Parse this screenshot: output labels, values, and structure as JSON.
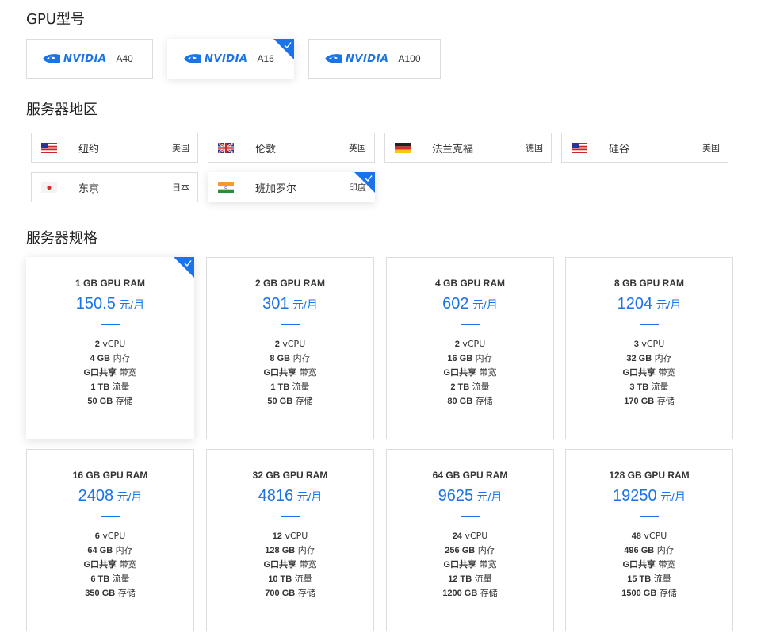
{
  "sections": {
    "gpu_title": "GPU型号",
    "region_title": "服务器地区",
    "spec_title": "服务器规格"
  },
  "gpu": {
    "brand": "NVIDIA",
    "options": [
      {
        "model": "A40",
        "selected": false
      },
      {
        "model": "A16",
        "selected": true
      },
      {
        "model": "A100",
        "selected": false
      }
    ]
  },
  "regions": [
    {
      "city": "纽约",
      "country": "美国",
      "flag": "us-flag",
      "selected": false
    },
    {
      "city": "伦敦",
      "country": "英国",
      "flag": "uk-flag",
      "selected": false
    },
    {
      "city": "法兰克福",
      "country": "德国",
      "flag": "de-flag",
      "selected": false
    },
    {
      "city": "硅谷",
      "country": "美国",
      "flag": "us-flag",
      "selected": false
    },
    {
      "city": "东京",
      "country": "日本",
      "flag": "jp-flag",
      "selected": false
    },
    {
      "city": "班加罗尔",
      "country": "印度",
      "flag": "in-flag",
      "selected": true
    }
  ],
  "price_unit": "元/月",
  "specs": [
    {
      "ram": "1 GB GPU RAM",
      "price": "150.5",
      "vcpu": "2",
      "mem": "4 GB",
      "bw": "G口共享",
      "traffic": "1 TB",
      "disk": "50 GB",
      "selected": true
    },
    {
      "ram": "2 GB GPU RAM",
      "price": "301",
      "vcpu": "2",
      "mem": "8 GB",
      "bw": "G口共享",
      "traffic": "1 TB",
      "disk": "50 GB",
      "selected": false
    },
    {
      "ram": "4 GB GPU RAM",
      "price": "602",
      "vcpu": "2",
      "mem": "16 GB",
      "bw": "G口共享",
      "traffic": "2 TB",
      "disk": "80 GB",
      "selected": false
    },
    {
      "ram": "8 GB GPU RAM",
      "price": "1204",
      "vcpu": "3",
      "mem": "32 GB",
      "bw": "G口共享",
      "traffic": "3 TB",
      "disk": "170 GB",
      "selected": false
    },
    {
      "ram": "16 GB GPU RAM",
      "price": "2408",
      "vcpu": "6",
      "mem": "64 GB",
      "bw": "G口共享",
      "traffic": "6 TB",
      "disk": "350 GB",
      "selected": false
    },
    {
      "ram": "32 GB GPU RAM",
      "price": "4816",
      "vcpu": "12",
      "mem": "128 GB",
      "bw": "G口共享",
      "traffic": "10 TB",
      "disk": "700 GB",
      "selected": false
    },
    {
      "ram": "64 GB GPU RAM",
      "price": "9625",
      "vcpu": "24",
      "mem": "256 GB",
      "bw": "G口共享",
      "traffic": "12 TB",
      "disk": "1200 GB",
      "selected": false
    },
    {
      "ram": "128 GB GPU RAM",
      "price": "19250",
      "vcpu": "48",
      "mem": "496 GB",
      "bw": "G口共享",
      "traffic": "15 TB",
      "disk": "1500 GB",
      "selected": false
    }
  ],
  "labels": {
    "vcpu": "vCPU",
    "mem": "内存",
    "bw": "带宽",
    "traffic": "流量",
    "disk": "存储"
  },
  "colors": {
    "accent": "#1a73e8",
    "border": "#dcdcdc"
  }
}
